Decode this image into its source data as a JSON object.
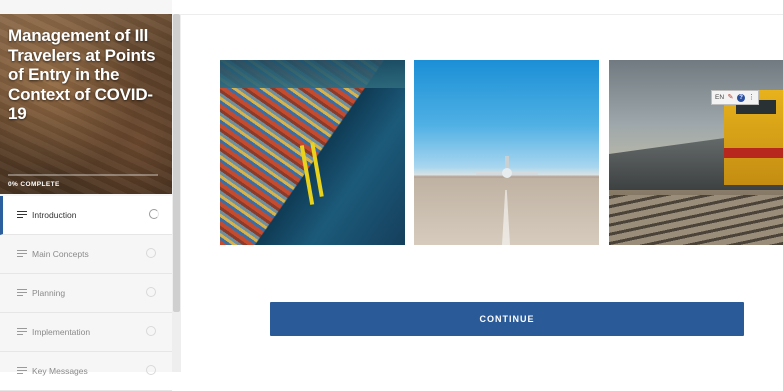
{
  "course": {
    "title": "Management of Ill Travelers at Points of Entry in the Context of COVID-19",
    "progress_percent": 0,
    "progress_label": "0% COMPLETE"
  },
  "lessons": [
    {
      "label": "Introduction",
      "active": true
    },
    {
      "label": "Main Concepts",
      "active": false
    },
    {
      "label": "Planning",
      "active": false
    },
    {
      "label": "Implementation",
      "active": false
    },
    {
      "label": "Key Messages",
      "active": false
    }
  ],
  "images": [
    {
      "subject": "cargo-port"
    },
    {
      "subject": "airport-runway"
    },
    {
      "subject": "freight-train"
    }
  ],
  "language_widget": {
    "code": "EN",
    "icons": [
      "translate-icon",
      "help-icon",
      "more-icon"
    ]
  },
  "main": {
    "continue_label": "CONTINUE"
  },
  "colors": {
    "accent": "#2a5b98",
    "active_border": "#2c5f9e"
  }
}
